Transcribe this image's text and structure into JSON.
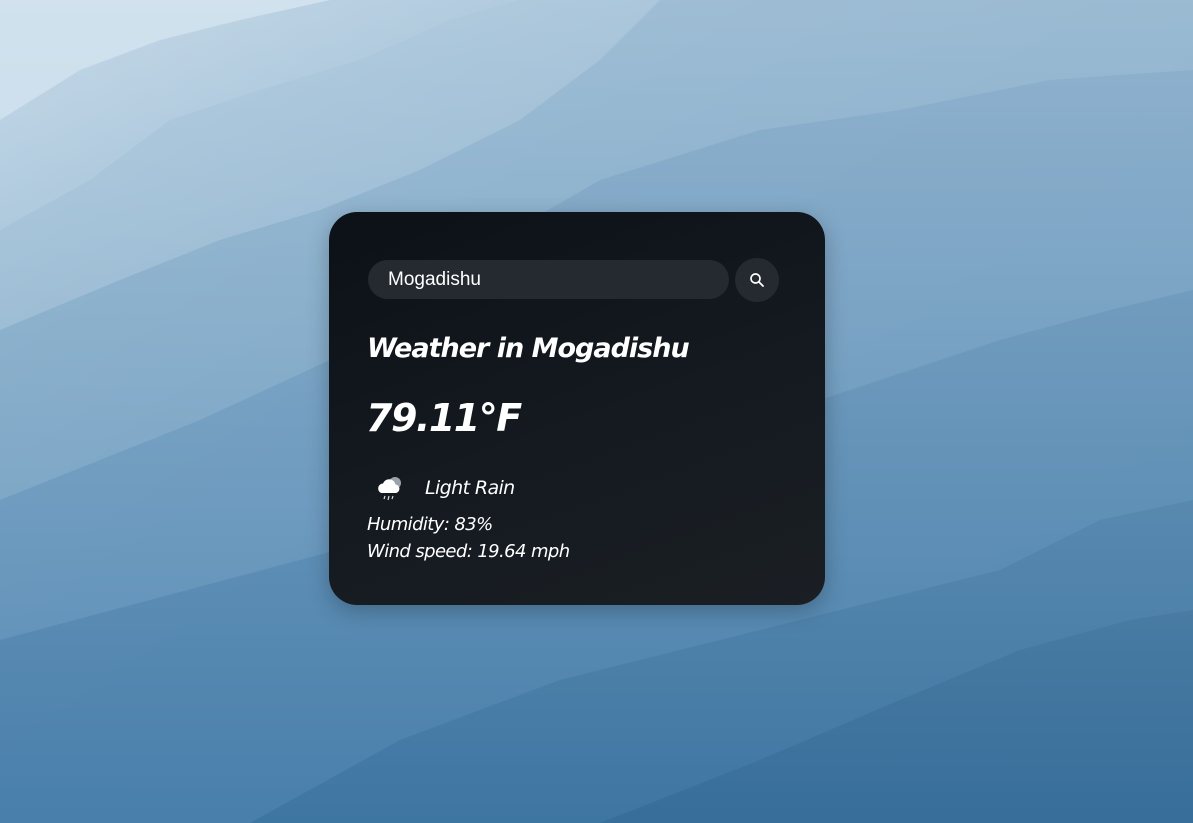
{
  "search": {
    "value": "Mogadishu",
    "placeholder": "Search"
  },
  "weather": {
    "title": "Weather in Mogadishu",
    "temperature": "79.11°F",
    "condition": "Light Rain",
    "condition_icon": "cloud-rain-icon",
    "humidity": "Humidity: 83%",
    "wind": "Wind speed: 19.64 mph"
  },
  "colors": {
    "card_background": "#141a20",
    "input_background": "#252a30",
    "text": "#ffffff",
    "background_sky": "#6f9dc0"
  }
}
